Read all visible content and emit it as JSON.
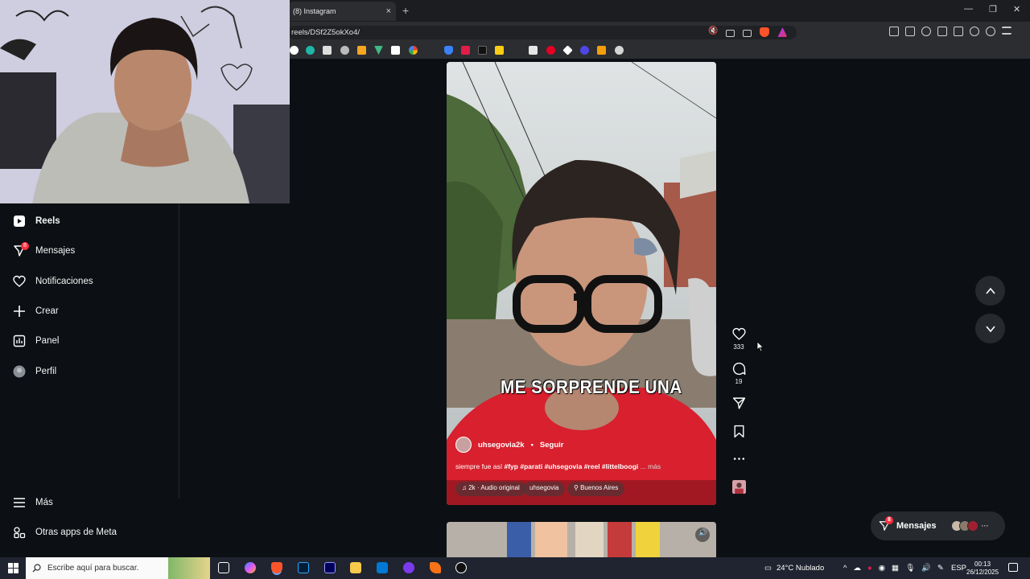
{
  "browser": {
    "tab_title": "(8) Instagram",
    "tab_close": "×",
    "new_tab": "+",
    "url": "reels/DSf2Z5okXo4/"
  },
  "sidebar": {
    "items": [
      {
        "label": "Reels",
        "icon": "reels-icon"
      },
      {
        "label": "Mensajes",
        "icon": "messages-icon",
        "badge": "8"
      },
      {
        "label": "Notificaciones",
        "icon": "heart-icon"
      },
      {
        "label": "Crear",
        "icon": "plus-icon"
      },
      {
        "label": "Panel",
        "icon": "dashboard-icon"
      },
      {
        "label": "Perfil",
        "icon": "avatar-icon"
      }
    ],
    "bottom": [
      {
        "label": "Más",
        "icon": "hamburger-icon"
      },
      {
        "label": "Otras apps de Meta",
        "icon": "apps-icon"
      }
    ]
  },
  "reel": {
    "caption": "ME SORPRENDE UNA",
    "author": "uhsegovia2k",
    "dot": "•",
    "follow": "Seguir",
    "desc_prefix": "siempre fue así",
    "hashtags": "#fyp #parati #uhsegovia #reel #littelboogi",
    "more": "... más",
    "audio": "2k · Audio original",
    "audio_user": "uhsegovia",
    "location": "Buenos Aires"
  },
  "actions": {
    "likes": "333",
    "comments": "19"
  },
  "messages_pill": {
    "label": "Mensajes",
    "badge": "8",
    "more": "···"
  },
  "taskbar": {
    "search_placeholder": "Escribe aquí para buscar.",
    "weather": "24°C  Nublado",
    "lang": "ESP",
    "time": "00:13",
    "date": "26/12/2025"
  },
  "colors": {
    "background": "#0c1014",
    "badge": "#ff3040",
    "reel_shirt": "#d8202e"
  }
}
